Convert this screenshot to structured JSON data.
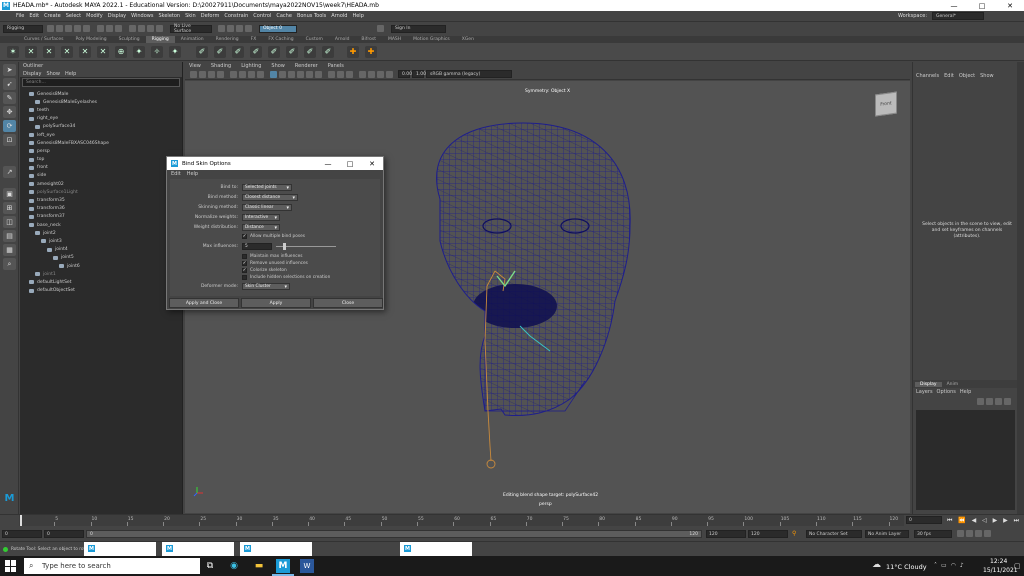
{
  "window": {
    "title": "HEADA.mb* - Autodesk MAYA 2022.1 - Educational Version: D:\\20027911\\Documents\\maya2022NOV15\\week7\\HEADA.mb",
    "minimize": "—",
    "maximize": "□",
    "close": "✕"
  },
  "menubar": {
    "items": [
      "File",
      "Edit",
      "Create",
      "Select",
      "Modify",
      "Display",
      "Windows",
      "Skeleton",
      "Skin",
      "Deform",
      "Constrain",
      "Control",
      "Cache",
      "Bonus Tools",
      "Arnold",
      "Help"
    ],
    "workspace_label": "Workspace:",
    "workspace_value": "General*"
  },
  "statusline": {
    "mode": "Rigging",
    "live_surface": "No Live Surface",
    "object_field": "Object 0",
    "sign_in": "Sign In"
  },
  "shelf": {
    "tabs": [
      "Curves / Surfaces",
      "Poly Modeling",
      "Sculpting",
      "Rigging",
      "Animation",
      "Rendering",
      "FX",
      "FX Caching",
      "Custom",
      "Arnold",
      "Bifrost",
      "MASH",
      "Motion Graphics",
      "XGen"
    ],
    "active_tab": "Rigging"
  },
  "outliner": {
    "title": "Outliner",
    "menus": [
      "Display",
      "Show",
      "Help"
    ],
    "search_placeholder": "Search...",
    "items": [
      {
        "label": "Genesis8Male",
        "indent": 1,
        "dim": false
      },
      {
        "label": "Genesis8MaleEyelashes",
        "indent": 2,
        "dim": false
      },
      {
        "label": "teeth",
        "indent": 1,
        "dim": false
      },
      {
        "label": "right_eye",
        "indent": 1,
        "dim": false
      },
      {
        "label": "polySurface34",
        "indent": 2,
        "dim": false
      },
      {
        "label": "left_eye",
        "indent": 1,
        "dim": false
      },
      {
        "label": "Genesis8MaleFBXASC046Shape",
        "indent": 1,
        "dim": false
      },
      {
        "label": "persp",
        "indent": 1,
        "dim": false
      },
      {
        "label": "top",
        "indent": 1,
        "dim": false
      },
      {
        "label": "front",
        "indent": 1,
        "dim": false
      },
      {
        "label": "side",
        "indent": 1,
        "dim": false
      },
      {
        "label": "amesight02",
        "indent": 1,
        "dim": false
      },
      {
        "label": "polySurface1Light",
        "indent": 1,
        "dim": true
      },
      {
        "label": "transform35",
        "indent": 1,
        "dim": false
      },
      {
        "label": "transform36",
        "indent": 1,
        "dim": false
      },
      {
        "label": "transform37",
        "indent": 1,
        "dim": false
      },
      {
        "label": "base_neck",
        "indent": 1,
        "dim": false
      },
      {
        "label": "joint2",
        "indent": 2,
        "dim": false
      },
      {
        "label": "joint3",
        "indent": 3,
        "dim": false
      },
      {
        "label": "joint4",
        "indent": 4,
        "dim": false
      },
      {
        "label": "joint5",
        "indent": 5,
        "dim": false
      },
      {
        "label": "joint6",
        "indent": 6,
        "dim": false
      },
      {
        "label": "joint1",
        "indent": 2,
        "dim": true
      },
      {
        "label": "defaultLightSet",
        "indent": 1,
        "dim": false
      },
      {
        "label": "defaultObjectSet",
        "indent": 1,
        "dim": false
      }
    ]
  },
  "viewport": {
    "menus": [
      "View",
      "Shading",
      "Lighting",
      "Show",
      "Renderer",
      "Panels"
    ],
    "gamma": "sRGB gamma (legacy)",
    "symmetry_label": "Symmetry: Object X",
    "editing_label": "Editing blend shape target: polySurface42",
    "camera_label": "persp",
    "view_cube": "Front"
  },
  "channelbox": {
    "menus": [
      "Channels",
      "Edit",
      "Object",
      "Show"
    ],
    "message": "Select objects in the scene to view, edit and set keyframes on channels (attributes)."
  },
  "layers": {
    "tabs": [
      "Display",
      "Anim"
    ],
    "menus": [
      "Layers",
      "Options",
      "Help"
    ]
  },
  "timeline": {
    "ticks": [
      "5",
      "10",
      "15",
      "20",
      "25",
      "30",
      "35",
      "40",
      "45",
      "50",
      "55",
      "60",
      "65",
      "70",
      "75",
      "80",
      "85",
      "90",
      "95",
      "100",
      "105",
      "110",
      "115",
      "120"
    ],
    "current_frame": "0",
    "range_start": "0",
    "range_start2": "0",
    "range_inner": "0",
    "range_end1": "120",
    "range_end2": "120",
    "range_end3": "120",
    "fps": "30 fps",
    "character_set": "No Character Set",
    "anim_layer": "No Anim Layer",
    "end_frame": "120"
  },
  "helpline": {
    "text": "Rotate Tool: Select an object to rotate."
  },
  "taskbar": {
    "search_placeholder": "Type here to search",
    "weather": "11°C  Cloudy",
    "time": "12:24",
    "date": "15/11/2021"
  },
  "dialog": {
    "title": "Bind Skin Options",
    "menus": [
      "Edit",
      "Help"
    ],
    "fields": {
      "bind_to_label": "Bind to:",
      "bind_to_value": "Selected joints",
      "bind_method_label": "Bind method:",
      "bind_method_value": "Closest distance",
      "skinning_method_label": "Skinning method:",
      "skinning_method_value": "Classic linear",
      "normalize_label": "Normalize weights:",
      "normalize_value": "Interactive",
      "weight_dist_label": "Weight distribution:",
      "weight_dist_value": "Distance",
      "allow_multiple_label": "Allow multiple bind poses",
      "max_influences_label": "Max influences:",
      "max_influences_value": "5",
      "maintain_max_label": "Maintain max influences",
      "remove_unused_label": "Remove unused influences",
      "colorize_label": "Colorize skeleton",
      "include_hidden_label": "Include hidden selections on creation",
      "deformer_mode_label": "Deformer mode:",
      "deformer_mode_value": "Skin Cluster"
    },
    "buttons": {
      "apply_close": "Apply and Close",
      "apply": "Apply",
      "close": "Close"
    }
  },
  "colors": {
    "wireframe": "#1e1e8c",
    "joint": "#c98a3c",
    "maya_blue": "#1a9bd7"
  }
}
